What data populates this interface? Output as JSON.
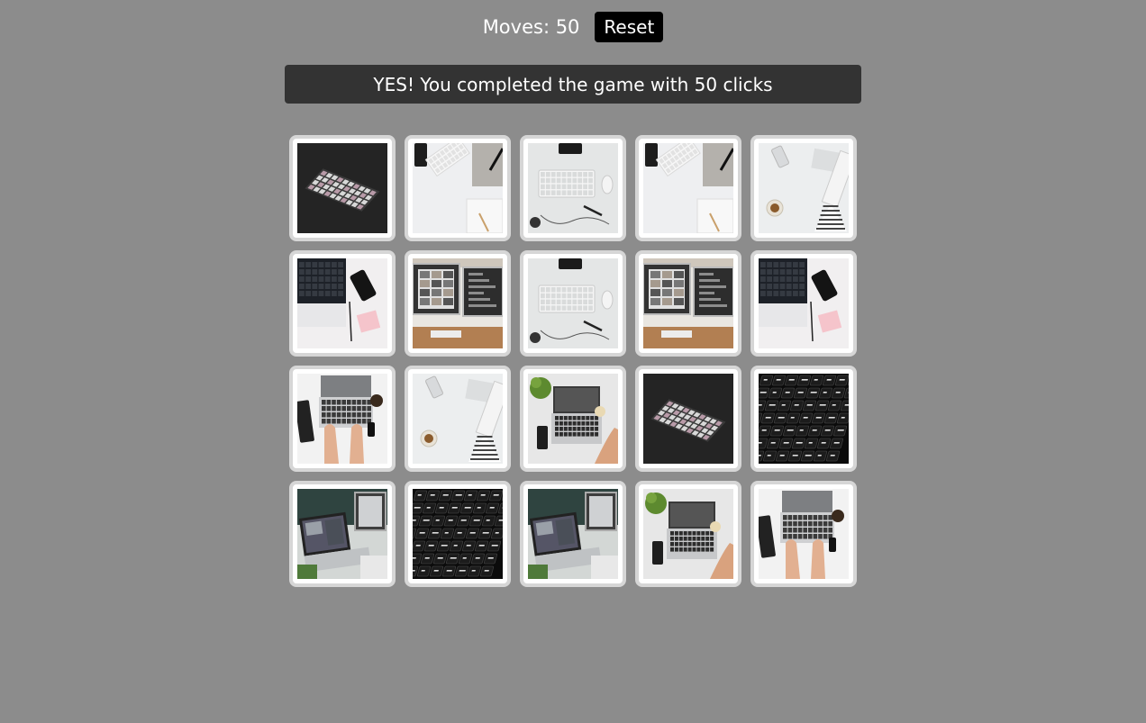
{
  "header": {
    "moves_label": "Moves: 50",
    "reset_label": "Reset"
  },
  "banner": {
    "message": "YES! You completed the game with 50 clicks"
  },
  "board": {
    "rows": 4,
    "columns": 5,
    "cards": [
      {
        "image": "keyboard-angled-dark"
      },
      {
        "image": "desk-keyboard-phone-notebook"
      },
      {
        "image": "keyboard-mouse-desk"
      },
      {
        "image": "desk-keyboard-phone-notebook"
      },
      {
        "image": "phone-coffee-flatlay"
      },
      {
        "image": "laptop-phone-pink-note"
      },
      {
        "image": "desktop-monitors"
      },
      {
        "image": "keyboard-mouse-desk"
      },
      {
        "image": "desktop-monitors"
      },
      {
        "image": "laptop-phone-pink-note"
      },
      {
        "image": "hands-typing-laptop"
      },
      {
        "image": "phone-coffee-flatlay"
      },
      {
        "image": "laptop-plant-coffee"
      },
      {
        "image": "keyboard-angled-dark"
      },
      {
        "image": "backlit-keyboard-closeup"
      },
      {
        "image": "laptop-office-desk"
      },
      {
        "image": "backlit-keyboard-closeup"
      },
      {
        "image": "laptop-office-desk"
      },
      {
        "image": "laptop-plant-coffee"
      },
      {
        "image": "hands-typing-laptop"
      }
    ]
  },
  "colors": {
    "page_background": "#8c8c8c",
    "banner_background": "#333333",
    "button_background": "#000000",
    "card_border": "#d6d6d6",
    "text": "#ffffff"
  }
}
